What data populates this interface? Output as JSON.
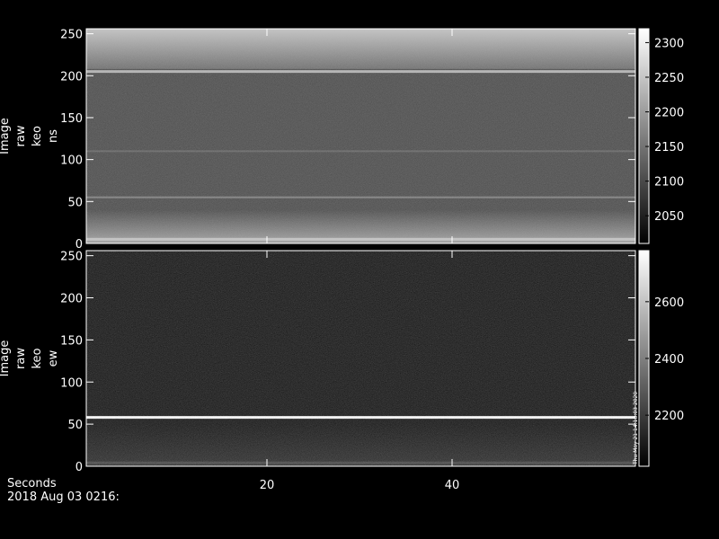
{
  "chart_data": [
    {
      "type": "heatmap",
      "ylabel_lines": [
        "Image",
        "raw",
        "keo",
        "ns"
      ],
      "yticks": [
        0,
        50,
        100,
        150,
        200,
        250
      ],
      "ylim": [
        0,
        256
      ],
      "xlim": [
        0,
        60
      ],
      "colorbar": {
        "ticks": [
          2050,
          2100,
          2150,
          2200,
          2250,
          2300
        ],
        "range": [
          2010,
          2320
        ]
      },
      "features": [
        {
          "kind": "bright-band",
          "y_range": [
            208,
            256
          ],
          "level": 2250
        },
        {
          "kind": "line",
          "y": 205,
          "level": 2230
        },
        {
          "kind": "faint-line",
          "y": 55,
          "level": 2170
        },
        {
          "kind": "faint-line",
          "y": 110,
          "level": 2140
        },
        {
          "kind": "bright-band",
          "y_range": [
            0,
            40
          ],
          "level": 2210
        },
        {
          "kind": "line",
          "y": 5,
          "level": 2250
        }
      ],
      "background_level": 2110
    },
    {
      "type": "heatmap",
      "ylabel_lines": [
        "Image",
        "raw",
        "keo",
        "ew"
      ],
      "yticks": [
        0,
        50,
        100,
        150,
        200,
        250
      ],
      "ylim": [
        0,
        256
      ],
      "xlim": [
        0,
        60
      ],
      "colorbar": {
        "ticks": [
          2200,
          2400,
          2600
        ],
        "range": [
          2020,
          2780
        ],
        "side_text": "Thu May 21 14:18:03 2020"
      },
      "features": [
        {
          "kind": "line",
          "y": 58,
          "level": 2760
        },
        {
          "kind": "bright-band",
          "y_range": [
            0,
            50
          ],
          "level": 2180
        },
        {
          "kind": "line",
          "y": 4,
          "level": 2250
        }
      ],
      "background_level": 2110
    }
  ],
  "x_axis": {
    "label": "Seconds",
    "ticks": [
      20,
      40
    ]
  },
  "timestamp": "2018 Aug 03 0216:"
}
